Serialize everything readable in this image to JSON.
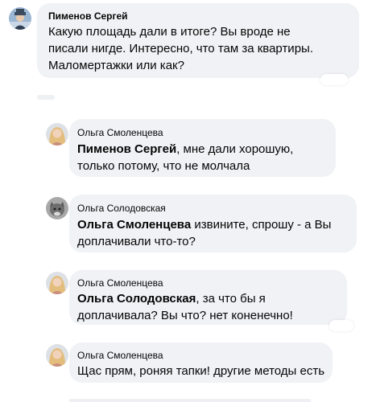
{
  "comments": [
    {
      "author": "Пименов Сергей",
      "text": "Какую площадь дали в итоге? Вы вроде не писали нигде. Интересно, что там за квартиры. Маломертажки или как?",
      "avatar": "man-with-hat-avatar"
    },
    {
      "author": "Ольга Смоленцева",
      "mention": "Пименов Сергей",
      "text": ", мне дали хорошую, только потому, что не молчала",
      "avatar": "woman-blonde-avatar"
    },
    {
      "author": "Ольга Солодовская",
      "mention": "Ольга Смоленцева",
      "text": " извините, спрошу - а Вы доплачивали что-то?",
      "avatar": "cat-avatar"
    },
    {
      "author": "Ольга Смоленцева",
      "mention": "Ольга Солодовская",
      "text": ", за что бы я доплачивала? Вы что? нет коненечно!",
      "avatar": "woman-blonde-avatar"
    },
    {
      "author": "Ольга Смоленцева",
      "text": "Щас прям, роняя тапки! другие методы есть",
      "avatar": "woman-blonde-avatar"
    }
  ],
  "colors": {
    "bubble": "#f0f2f5",
    "text": "#050505",
    "page": "#ffffff"
  }
}
